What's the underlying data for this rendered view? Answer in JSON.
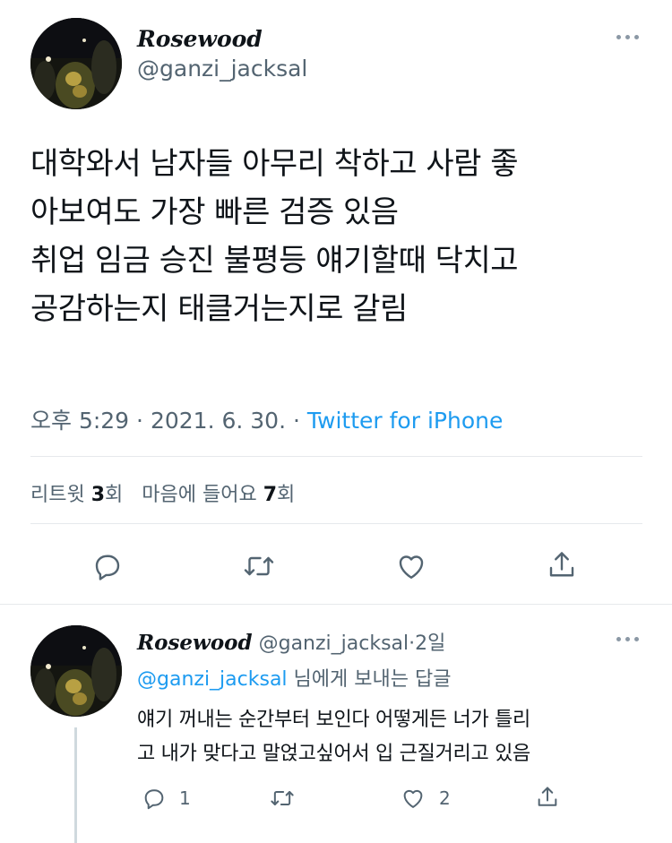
{
  "tweet": {
    "display_name": "Rosewood",
    "handle": "@ganzi_jacksal",
    "text_lines": [
      "대학와서 남자들 아무리 착하고 사람 좋",
      "아보여도 가장 빠른 검증 있음",
      "취업 임금 승진 불평등 얘기할때 닥치고",
      "공감하는지 태클거는지로 갈림"
    ],
    "time": "오후 5:29",
    "date": "2021. 6. 30.",
    "separator": "·",
    "source": "Twitter for iPhone",
    "stats": {
      "retweet_label": "리트윗",
      "retweet_count": "3",
      "retweet_unit": "회",
      "like_label": "마음에 들어요",
      "like_count": "7",
      "like_unit": "회"
    },
    "actions": [
      "reply-icon",
      "retweet-icon",
      "like-icon",
      "share-icon"
    ]
  },
  "reply": {
    "display_name": "Rosewood",
    "handle": "@ganzi_jacksal",
    "separator": "·",
    "age": "2일",
    "replying_to_handle": "@ganzi_jacksal",
    "replying_to_suffix": "님에게 보내는 답글",
    "text_lines": [
      "얘기 꺼내는 순간부터 보인다 어떻게든 너가 틀리",
      "고 내가 맞다고 말얹고싶어서 입 근질거리고 있음"
    ],
    "reply_count": "1",
    "like_count": "2"
  },
  "colors": {
    "link": "#1d9bf0",
    "muted": "#536471",
    "text": "#0f1419",
    "divider": "#e6e9ec"
  }
}
